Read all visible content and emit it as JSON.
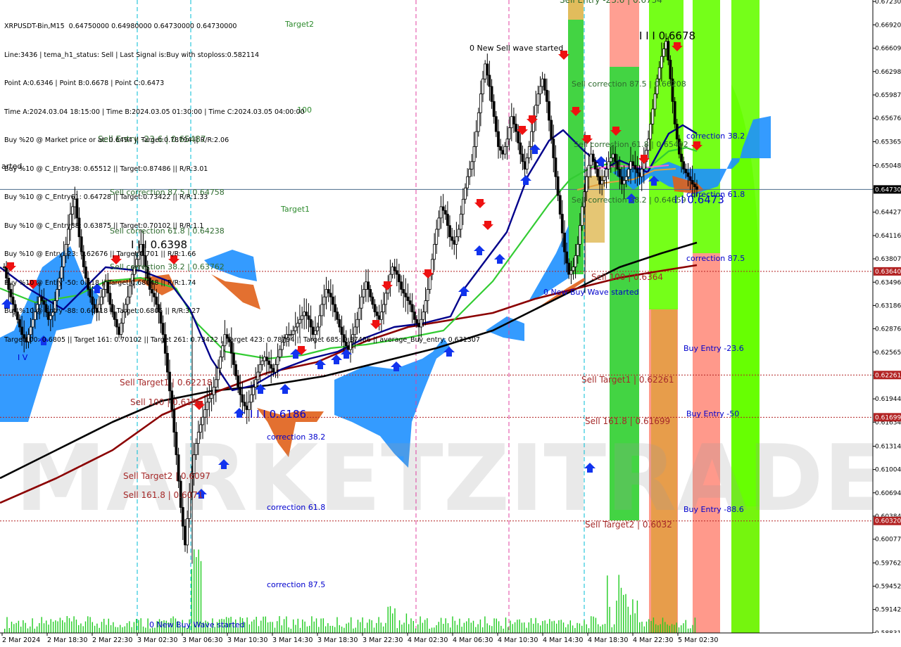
{
  "header": {
    "lines": [
      "XRPUSDT-Bin,M15  0.64750000 0.64980000 0.64730000 0.64730000",
      "Line:3436 | tema_h1_status: Sell | Last Signal is:Buy with stoploss:0.582114",
      "Point A:0.6346 | Point B:0.6678 | Point C:0.6473",
      "Time A:2024.03.04 18:15:00 | Time B:2024.03.05 01:30:00 | Time C:2024.03.05 04:00:00",
      "Buy %20 @ Market price or at: 0.6494 || Target:0.78794 || R/R:2.06",
      "Buy %10 @ C_Entry38: 0.65512 || Target:0.87486 || R/R:3.01",
      "Buy %10 @ C_Entry61: 0.64728 || Target:0.73422 || R/R:1.33",
      "Buy %10 @ C_Entry88: 0.63875 || Target:0.70102 || R/R:1.1",
      "Buy %10 @ Entry -23: 0.62676 || Target:0.701 || R/R:1.66",
      "Buy %10 @ Entry -50: 0.618 || Target:0.68048 || R/R:1.74",
      "Buy %10 @ Entry -88: 0.60518 || Target:0.6805 || R/R:3.27",
      "Target100: 0.6805 || Target 161: 0.70102 || Target 261: 0.73422 || Target 423: 0.78794 || Target 685: 0.87486 || average_Buy_entry: 0.631307"
    ]
  },
  "colors": {
    "green_zone": "#22cc22",
    "lime_zone": "#66ff00",
    "orange_zone": "#d4a017",
    "salmon_zone": "#ff7f6e",
    "cloud_blue": "#1e90ff",
    "cloud_orange": "#e0601a",
    "ema_navy": "#00008b",
    "ema_green": "#33cc33",
    "ma_maroon": "#8b0000",
    "ma_black": "#000000",
    "level_line": "#b22222",
    "current_line": "#4a6b8a",
    "divider_cyan": "#00bcd4",
    "divider_magenta": "#e040a0"
  },
  "watermark": "MARKETZITRADE",
  "chart_data": {
    "type": "candlestick",
    "symbol": "XRPUSDT-Bin",
    "timeframe": "M15",
    "ylim": [
      0.5883,
      0.6725
    ],
    "price_ticks": [
      "0.67230",
      "0.66920",
      "0.66609",
      "0.66298",
      "0.65987",
      "0.65676",
      "0.65365",
      "0.65048",
      "0.64737",
      "0.64427",
      "0.64116",
      "0.63807",
      "0.63496",
      "0.63186",
      "0.62876",
      "0.62565",
      "0.62254",
      "0.61944",
      "0.61634",
      "0.61314",
      "0.61004",
      "0.60694",
      "0.60384",
      "0.60077",
      "0.59762",
      "0.59452",
      "0.59142",
      "0.58831"
    ],
    "price_tick_values": [
      0.6723,
      0.6692,
      0.66609,
      0.66298,
      0.65987,
      0.65676,
      0.65365,
      0.65048,
      0.64737,
      0.64427,
      0.64116,
      0.63807,
      0.63496,
      0.63186,
      0.62876,
      0.62565,
      0.62254,
      0.61944,
      0.61634,
      0.61314,
      0.61004,
      0.60694,
      0.60384,
      0.60077,
      0.59762,
      0.59452,
      0.59142,
      0.58831
    ],
    "highlight_prices": [
      {
        "label": "0.64730",
        "value": 0.6473,
        "color": "#000000"
      },
      {
        "label": "0.63640",
        "value": 0.6364,
        "color": "#b22222"
      },
      {
        "label": "0.62261",
        "value": 0.62261,
        "color": "#b22222"
      },
      {
        "label": "0.61699",
        "value": 0.61699,
        "color": "#b22222"
      },
      {
        "label": "0.60320",
        "value": 0.6032,
        "color": "#b22222"
      }
    ],
    "time_labels": [
      "2 Mar 2024",
      "2 Mar 18:30",
      "2 Mar 22:30",
      "3 Mar 02:30",
      "3 Mar 06:30",
      "3 Mar 10:30",
      "3 Mar 14:30",
      "3 Mar 18:30",
      "3 Mar 22:30",
      "4 Mar 02:30",
      "4 Mar 06:30",
      "4 Mar 10:30",
      "4 Mar 14:30",
      "4 Mar 18:30",
      "4 Mar 22:30",
      "5 Mar 02:30"
    ],
    "close_path": [
      0.637,
      0.634,
      0.632,
      0.63,
      0.628,
      0.627,
      0.629,
      0.631,
      0.633,
      0.632,
      0.63,
      0.631,
      0.634,
      0.637,
      0.64,
      0.644,
      0.646,
      0.641,
      0.637,
      0.634,
      0.632,
      0.631,
      0.633,
      0.635,
      0.632,
      0.63,
      0.628,
      0.631,
      0.633,
      0.636,
      0.638,
      0.64,
      0.637,
      0.634,
      0.633,
      0.631,
      0.628,
      0.623,
      0.618,
      0.612,
      0.605,
      0.6,
      0.607,
      0.612,
      0.615,
      0.617,
      0.619,
      0.62,
      0.622,
      0.625,
      0.628,
      0.627,
      0.624,
      0.621,
      0.619,
      0.618,
      0.62,
      0.622,
      0.624,
      0.625,
      0.624,
      0.623,
      0.625,
      0.627,
      0.628,
      0.628,
      0.629,
      0.63,
      0.631,
      0.63,
      0.628,
      0.629,
      0.632,
      0.634,
      0.633,
      0.631,
      0.629,
      0.627,
      0.626,
      0.628,
      0.63,
      0.633,
      0.635,
      0.633,
      0.631,
      0.63,
      0.632,
      0.635,
      0.637,
      0.636,
      0.634,
      0.633,
      0.632,
      0.63,
      0.629,
      0.631,
      0.634,
      0.638,
      0.642,
      0.645,
      0.644,
      0.641,
      0.64,
      0.642,
      0.646,
      0.649,
      0.651,
      0.655,
      0.66,
      0.664,
      0.661,
      0.657,
      0.653,
      0.652,
      0.654,
      0.657,
      0.655,
      0.652,
      0.65,
      0.653,
      0.657,
      0.66,
      0.662,
      0.659,
      0.654,
      0.649,
      0.644,
      0.639,
      0.636,
      0.637,
      0.64,
      0.645,
      0.649,
      0.652,
      0.65,
      0.648,
      0.649,
      0.651,
      0.652,
      0.65,
      0.648,
      0.649,
      0.651,
      0.65,
      0.649,
      0.651,
      0.654,
      0.658,
      0.662,
      0.665,
      0.667,
      0.662,
      0.656,
      0.652,
      0.65,
      0.649,
      0.648,
      0.6473
    ]
  },
  "labels": [
    {
      "t": "Target2",
      "x": 405,
      "y": 38,
      "c": "#2e8b2e"
    },
    {
      "t": "Target1",
      "x": 399,
      "y": 301,
      "c": "#2e8b2e"
    },
    {
      "t": "100",
      "x": 422,
      "y": 160,
      "c": "#2e8b2e"
    },
    {
      "t": "Sell Entry -23.6 | 0.65487",
      "x": 139,
      "y": 202,
      "c": "#2e6b2e",
      "s": 12
    },
    {
      "t": "arted",
      "x": 2,
      "y": 240,
      "c": "#000"
    },
    {
      "t": "Sell correction 87.5 | 0.64758",
      "x": 156,
      "y": 277,
      "c": "#2e6b2e"
    },
    {
      "t": "Sell correction 61.8 | 0.64238",
      "x": 156,
      "y": 332,
      "c": "#2e6b2e"
    },
    {
      "t": "Sell correction 38.2 | 0.63762",
      "x": 156,
      "y": 383,
      "c": "#2e6b2e"
    },
    {
      "t": "I I I 0.6398",
      "x": 186,
      "y": 353,
      "c": "#000",
      "s": 15
    },
    {
      "t": "I V",
      "x": 25,
      "y": 512,
      "c": "#0000cd"
    },
    {
      "t": "Sell Target1 | 0.62218",
      "x": 170,
      "y": 548,
      "c": "#a52a2a",
      "s": 12
    },
    {
      "t": "Sell 100 | 0.6196",
      "x": 185,
      "y": 576,
      "c": "#a52a2a",
      "s": 12
    },
    {
      "t": "I I I 0.6186",
      "x": 355,
      "y": 594,
      "c": "#0000cd",
      "s": 15
    },
    {
      "t": "correction 38.2",
      "x": 379,
      "y": 625,
      "c": "#0000cd"
    },
    {
      "t": "Sell Target2 | 0.6097",
      "x": 175,
      "y": 681,
      "c": "#a52a2a",
      "s": 12
    },
    {
      "t": "Sell 161.8 | 0.6071",
      "x": 175,
      "y": 708,
      "c": "#a52a2a",
      "s": 12
    },
    {
      "t": "correction 61.8",
      "x": 379,
      "y": 725,
      "c": "#0000cd"
    },
    {
      "t": "correction 87.5",
      "x": 379,
      "y": 835,
      "c": "#0000cd"
    },
    {
      "t": "0 New Buy Wave started",
      "x": 212,
      "y": 892,
      "c": "#0000cd"
    },
    {
      "t": "0 New Sell wave started",
      "x": 667,
      "y": 72,
      "c": "#000"
    },
    {
      "t": "I I I 0.6678",
      "x": 908,
      "y": 56,
      "c": "#000",
      "s": 15
    },
    {
      "t": "Sell correction 87.5 | 0.66208",
      "x": 812,
      "y": 123,
      "c": "#2e6b2e"
    },
    {
      "t": "Sell correction 61.8 | 0.65402",
      "x": 815,
      "y": 209,
      "c": "#2e6b2e"
    },
    {
      "t": "correction 38.2",
      "x": 975,
      "y": 197,
      "c": "#0000cd"
    },
    {
      "t": "Sell correction 38.2 | 0.64659",
      "x": 812,
      "y": 288,
      "c": "#2e6b2e"
    },
    {
      "t": "I I 0.6473",
      "x": 958,
      "y": 289,
      "c": "#0000cd",
      "s": 15
    },
    {
      "t": "correction 61.8",
      "x": 975,
      "y": 280,
      "c": "#0000cd"
    },
    {
      "t": "correction 87.5",
      "x": 975,
      "y": 371,
      "c": "#0000cd"
    },
    {
      "t": "Sell 100 | 0.6364",
      "x": 840,
      "y": 398,
      "c": "#a52a2a",
      "s": 12
    },
    {
      "t": "0 New Buy Wave started",
      "x": 772,
      "y": 419,
      "c": "#0000cd"
    },
    {
      "t": "Buy Entry -23.6",
      "x": 971,
      "y": 499,
      "c": "#0000cd"
    },
    {
      "t": "Sell Target1 | 0.62261",
      "x": 826,
      "y": 544,
      "c": "#a52a2a",
      "s": 12
    },
    {
      "t": "Buy Entry -50",
      "x": 975,
      "y": 592,
      "c": "#0000cd"
    },
    {
      "t": "Sell 161.8 | 0.61699",
      "x": 831,
      "y": 603,
      "c": "#a52a2a",
      "s": 12
    },
    {
      "t": "Buy Entry -88.6",
      "x": 971,
      "y": 728,
      "c": "#0000cd"
    },
    {
      "t": "Sell Target2 | 0.6032",
      "x": 831,
      "y": 750,
      "c": "#a52a2a",
      "s": 12
    },
    {
      "t": "Sell Entry -23.6 | 0.6734",
      "x": 795,
      "y": 4,
      "c": "#2e6b2e",
      "s": 12
    }
  ]
}
